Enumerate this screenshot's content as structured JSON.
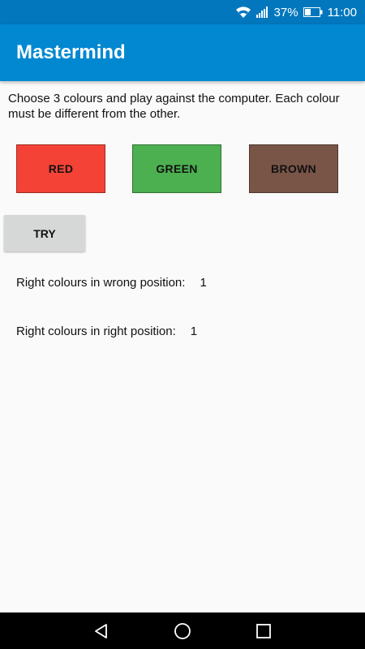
{
  "status_bar": {
    "battery": "37%",
    "time": "11:00",
    "icons": [
      "wifi-icon",
      "signal-icon",
      "battery-icon"
    ]
  },
  "app_bar": {
    "title": "Mastermind"
  },
  "main": {
    "instructions": "Choose 3 colours and play against the computer. Each colour must be different from the other.",
    "colour_buttons": [
      {
        "label": "RED",
        "color": "#f44336"
      },
      {
        "label": "GREEN",
        "color": "#4caf50"
      },
      {
        "label": "BROWN",
        "color": "#795548"
      }
    ],
    "try_label": "TRY",
    "results": {
      "wrong_position_label": "Right colours in wrong position:",
      "wrong_position_value": "1",
      "right_position_label": "Right colours in right position:",
      "right_position_value": "1"
    }
  },
  "nav_bar": {
    "icons": [
      "back-icon",
      "home-icon",
      "recents-icon"
    ]
  },
  "colors": {
    "status_bar": "#0277bd",
    "app_bar": "#0288d1",
    "background": "#fafafa",
    "try_button": "#d6d7d7"
  }
}
